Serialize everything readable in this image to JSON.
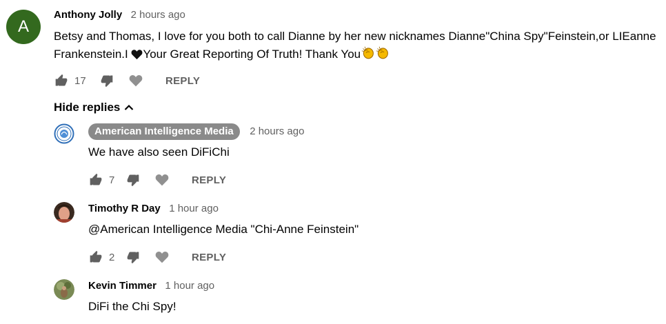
{
  "comment": {
    "avatar_letter": "A",
    "author": "Anthony Jolly",
    "timestamp": "2 hours ago",
    "text_line1": "Betsy and Thomas, I love for you both to call Dianne by her new nicknames Dianne\"China Spy\"Feinstein,or LIEanne",
    "text_line2_a": "Frankenstein.I ",
    "text_line2_b": "Your Great Reporting Of Truth! Thank You",
    "likes": "17",
    "reply_label": "REPLY",
    "icons": [
      "thumb-up-icon",
      "thumb-down-icon",
      "heart-icon",
      "black-heart-icon",
      "clapping-hands-icon"
    ]
  },
  "hide_replies_label": "Hide replies",
  "replies": [
    {
      "author": "American Intelligence Media",
      "author_is_channel_owner": true,
      "timestamp": "2 hours ago",
      "text": "We have also seen DiFiChi",
      "likes": "7",
      "reply_label": "REPLY"
    },
    {
      "author": "Timothy R Day",
      "timestamp": "1 hour ago",
      "text": "@American Intelligence Media \"Chi-Anne Feinstein\"",
      "likes": "2",
      "reply_label": "REPLY"
    },
    {
      "author": "Kevin Timmer",
      "timestamp": "1 hour ago",
      "text": "DiFi the Chi Spy!"
    }
  ],
  "colors": {
    "avatar_bg": "#33691e",
    "badge_bg": "#8a8a8a",
    "secondary_text": "#606060"
  }
}
